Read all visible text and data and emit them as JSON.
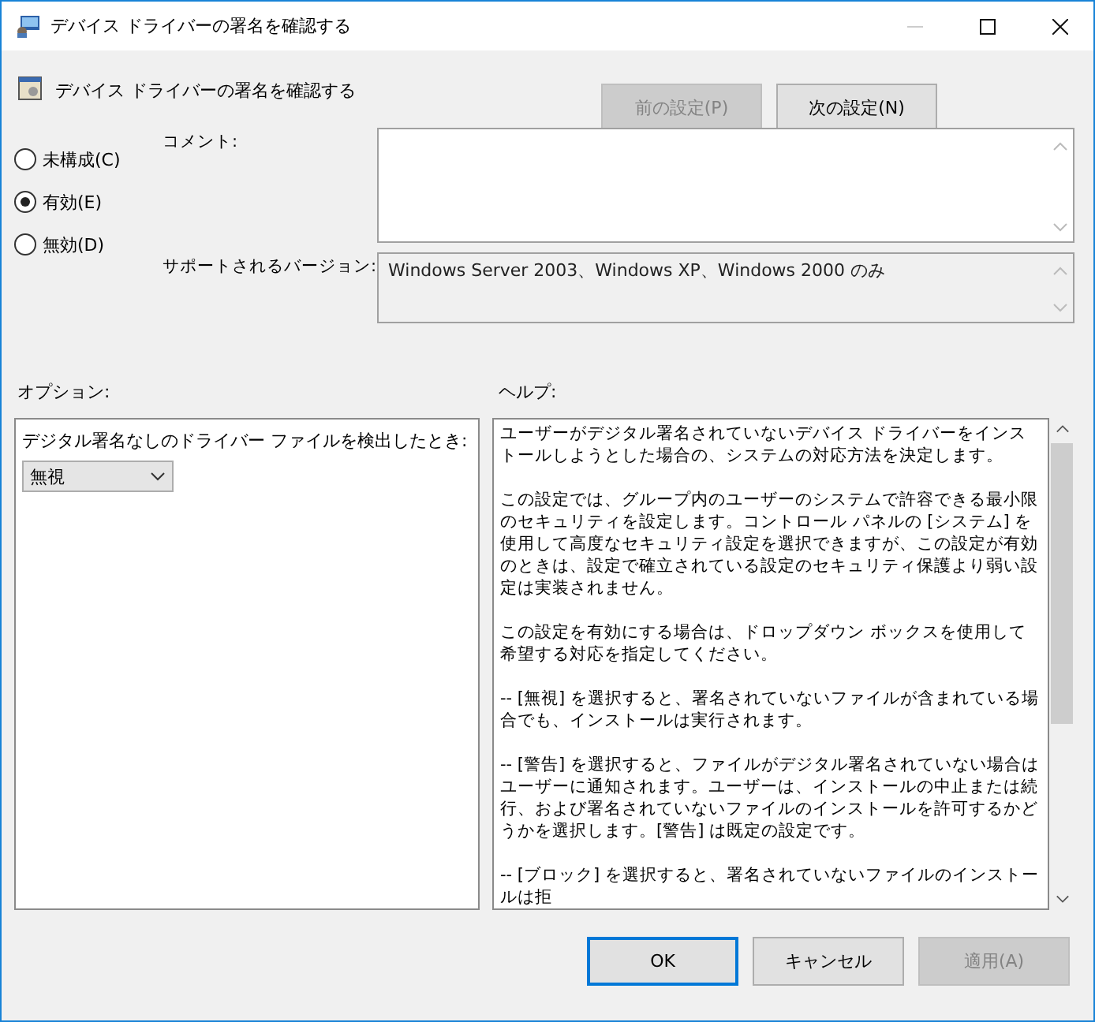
{
  "window": {
    "title": "デバイス ドライバーの署名を確認する"
  },
  "header": {
    "policy_name": "デバイス ドライバーの署名を確認する",
    "prev_button": {
      "label": "前の設定(P)",
      "disabled": true
    },
    "next_button": {
      "label": "次の設定(N)",
      "disabled": false
    }
  },
  "states": [
    {
      "label": "未構成(C)",
      "selected": false
    },
    {
      "label": "有効(E)",
      "selected": true
    },
    {
      "label": "無効(D)",
      "selected": false
    }
  ],
  "comment": {
    "label": "コメント:"
  },
  "supported": {
    "label": "サポートされるバージョン:",
    "value": "Windows Server 2003、Windows XP、Windows 2000 のみ"
  },
  "options": {
    "label": "オプション:",
    "field_label": "デジタル署名なしのドライバー ファイルを検出したとき:",
    "dropdown_value": "無視"
  },
  "help": {
    "label": "ヘルプ:",
    "paragraphs": [
      "ユーザーがデジタル署名されていないデバイス ドライバーをインストールしようとした場合の、システムの対応方法を決定します。",
      "この設定では、グループ内のユーザーのシステムで許容できる最小限のセキュリティを設定します。コントロール パネルの [システム] を使用して高度なセキュリティ設定を選択できますが、この設定が有効のときは、設定で確立されている設定のセキュリティ保護より弱い設定は実装されません。",
      "この設定を有効にする場合は、ドロップダウン ボックスを使用して希望する対応を指定してください。",
      "-- [無視] を選択すると、署名されていないファイルが含まれている場合でも、インストールは実行されます。",
      "-- [警告] を選択すると、ファイルがデジタル署名されていない場合はユーザーに通知されます。ユーザーは、インストールの中止または続行、および署名されていないファイルのインストールを許可するかどうかを選択します。[警告] は既定の設定です。",
      "-- [ブロック] を選択すると、署名されていないファイルのインストールは拒"
    ]
  },
  "buttons": [
    {
      "label": "OK",
      "kind": "default",
      "disabled": false
    },
    {
      "label": "キャンセル",
      "kind": "normal",
      "disabled": false
    },
    {
      "label": "適用(A)",
      "kind": "normal",
      "disabled": true
    }
  ]
}
